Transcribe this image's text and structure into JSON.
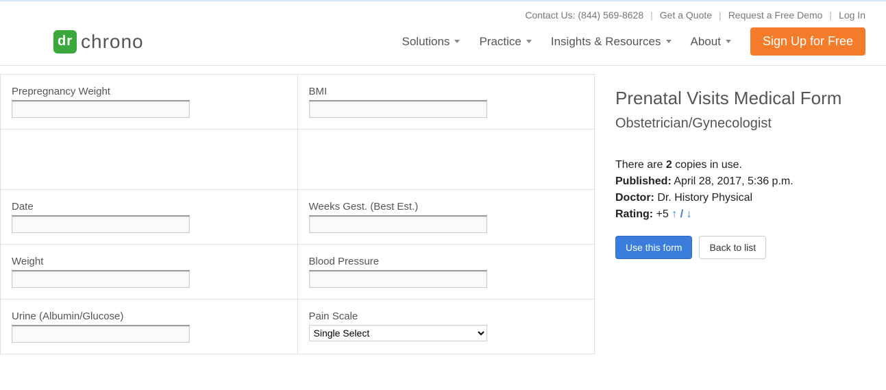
{
  "topbar": {
    "contact": "Contact Us: (844) 569-8628",
    "quote": "Get a Quote",
    "demo": "Request a Free Demo",
    "login": "Log In"
  },
  "logo": {
    "badge": "dr",
    "text": "chrono"
  },
  "nav": {
    "solutions": "Solutions",
    "practice": "Practice",
    "insights": "Insights & Resources",
    "about": "About",
    "signup": "Sign Up for Free"
  },
  "form": {
    "prepregnancy_weight": {
      "label": "Prepregnancy Weight",
      "value": ""
    },
    "bmi": {
      "label": "BMI",
      "value": ""
    },
    "date": {
      "label": "Date",
      "value": ""
    },
    "weeks_gest": {
      "label": "Weeks Gest. (Best Est.)",
      "value": ""
    },
    "weight": {
      "label": "Weight",
      "value": ""
    },
    "blood_pressure": {
      "label": "Blood Pressure",
      "value": ""
    },
    "urine": {
      "label": "Urine (Albumin/Glucose)",
      "value": ""
    },
    "pain_scale": {
      "label": "Pain Scale",
      "selected": "Single Select"
    }
  },
  "sidebar": {
    "title": "Prenatal Visits Medical Form",
    "subtitle": "Obstetrician/Gynecologist",
    "copies_prefix": "There are ",
    "copies_count": "2",
    "copies_suffix": " copies in use.",
    "published_label": "Published:",
    "published_value": " April 28, 2017, 5:36 p.m.",
    "doctor_label": "Doctor:",
    "doctor_value": " Dr. History Physical",
    "rating_label": "Rating:",
    "rating_value": " +5  ",
    "rating_sep": " / ",
    "use_form": "Use this form",
    "back": "Back to list"
  }
}
